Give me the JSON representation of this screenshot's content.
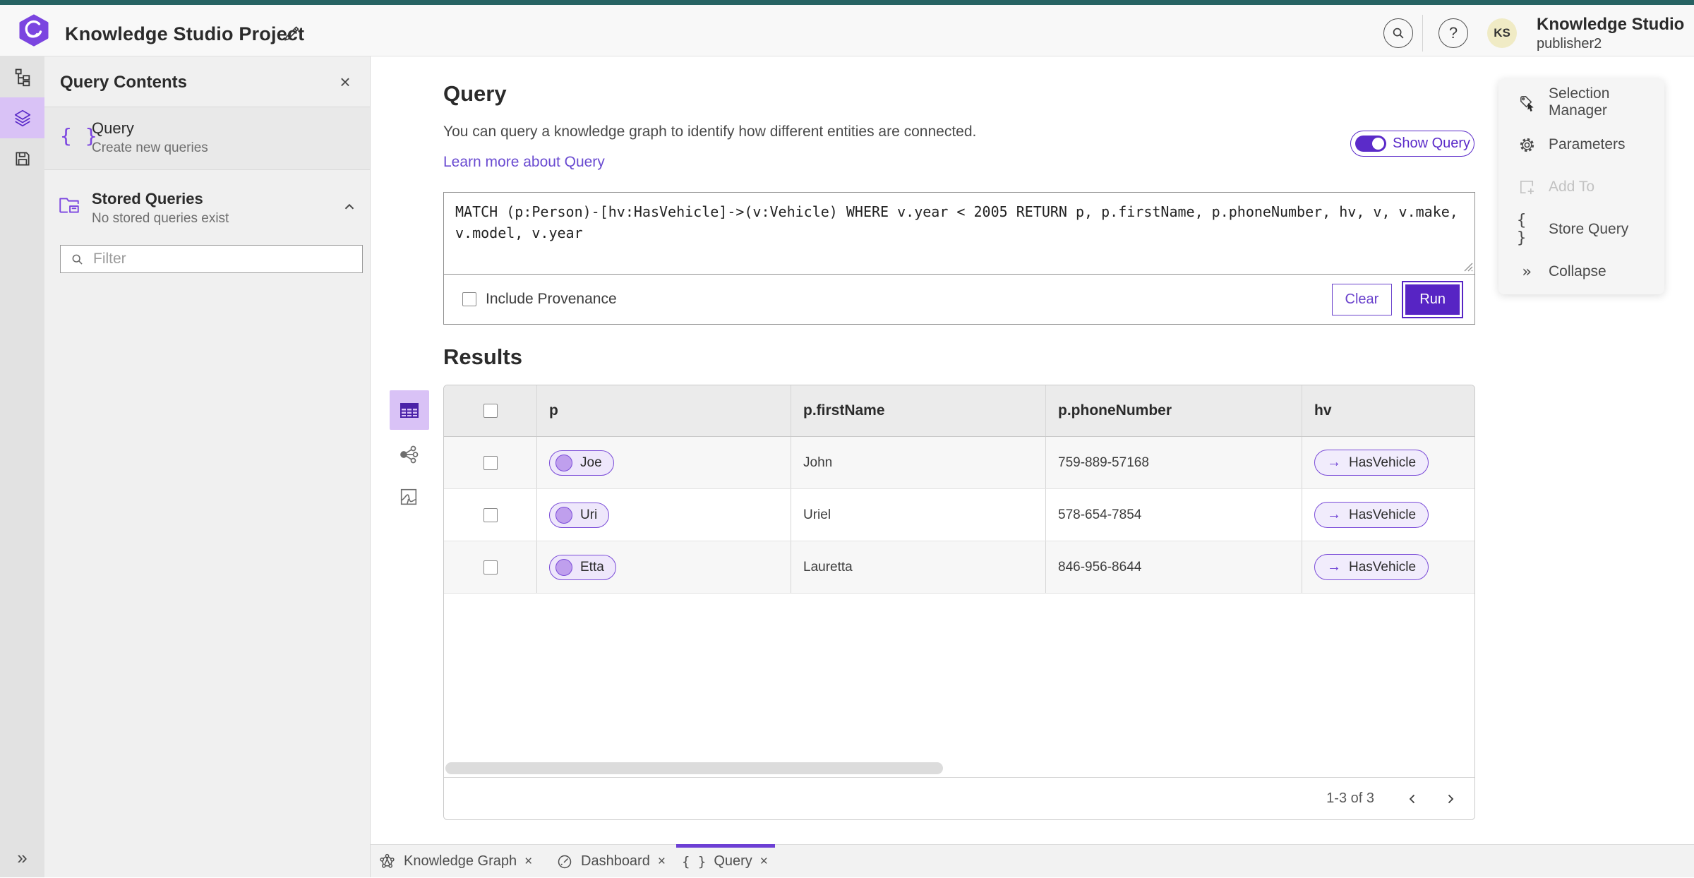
{
  "topbar": {
    "title": "Knowledge Studio Project",
    "org_name": "Knowledge Studio",
    "user_name": "publisher2",
    "avatar_initials": "KS"
  },
  "left_panel": {
    "title": "Query Contents",
    "query_item": {
      "title": "Query",
      "subtitle": "Create new queries"
    },
    "stored_queries": {
      "title": "Stored Queries",
      "subtitle": "No stored queries exist"
    },
    "filter_placeholder": "Filter"
  },
  "query_section": {
    "heading": "Query",
    "description": "You can query a knowledge graph to identify how different entities are connected.",
    "learn_more": "Learn more about Query",
    "show_query_label": "Show Query",
    "query_text": "MATCH (p:Person)-[hv:HasVehicle]->(v:Vehicle) WHERE v.year < 2005 RETURN p, p.firstName, p.phoneNumber, hv, v, v.make, v.model, v.year",
    "include_provenance_label": "Include Provenance",
    "clear_label": "Clear",
    "run_label": "Run"
  },
  "results": {
    "heading": "Results",
    "columns": [
      "p",
      "p.firstName",
      "p.phoneNumber",
      "hv"
    ],
    "rows": [
      {
        "p": "Joe",
        "firstName": "John",
        "phoneNumber": "759-889-57168",
        "hv": "HasVehicle"
      },
      {
        "p": "Uri",
        "firstName": "Uriel",
        "phoneNumber": "578-654-7854",
        "hv": "HasVehicle"
      },
      {
        "p": "Etta",
        "firstName": "Lauretta",
        "phoneNumber": "846-956-8644",
        "hv": "HasVehicle"
      }
    ],
    "pagination": "1-3 of 3"
  },
  "right_panel": {
    "items": [
      {
        "label": "Selection Manager"
      },
      {
        "label": "Parameters"
      },
      {
        "label": "Add To"
      },
      {
        "label": "Store Query"
      },
      {
        "label": "Collapse"
      }
    ]
  },
  "bottom_tabs": [
    {
      "label": "Knowledge Graph"
    },
    {
      "label": "Dashboard"
    },
    {
      "label": "Query"
    }
  ],
  "icons": {
    "close": "×",
    "braces": "{ }",
    "collapse_right": "»",
    "arrow_right": "→",
    "help": "?"
  },
  "colors": {
    "accent_purple": "#5b2bc9",
    "accent_purple_light": "#d9c2f6",
    "pill_fill": "#eee7fb",
    "teal_strip": "#276363",
    "header_bg": "#f8f8f8",
    "panel_bg": "#f0f0f0",
    "table_header_bg": "#ebebeb",
    "row_alt_bg": "#f7f7f7"
  }
}
